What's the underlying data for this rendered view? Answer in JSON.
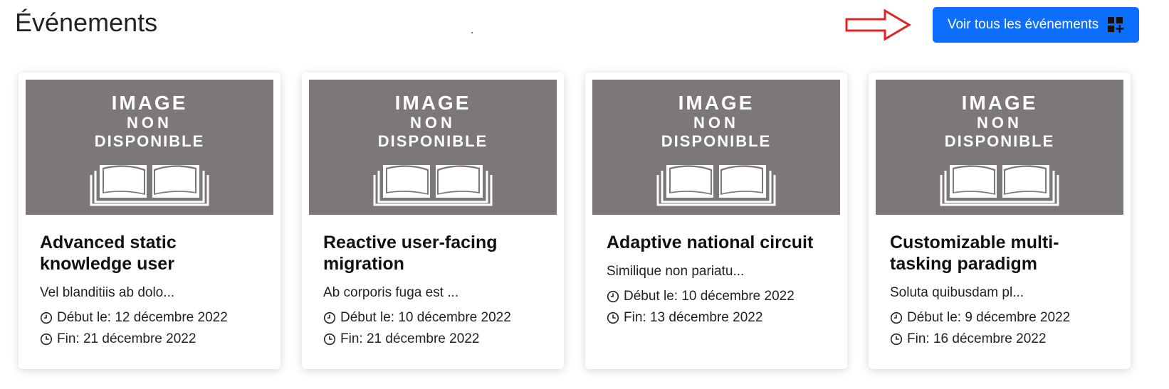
{
  "header": {
    "title": "Événements",
    "view_all_label": "Voir tous les événements",
    "view_all_icon": "grid-plus-icon",
    "annotation_arrow_color": "#e02424",
    "button_color": "#0d6efd"
  },
  "placeholder_image": {
    "line1": "IMAGE",
    "line2": "NON",
    "line3": "DISPONIBLE",
    "background": "#7c7878",
    "icon": "open-book-icon"
  },
  "events": [
    {
      "title": "Advanced static knowledge user",
      "description": "Vel blanditiis ab dolo...",
      "start_label": "Début le:",
      "start": "12 décembre 2022",
      "end_label": "Fin:",
      "end": "21 décembre 2022"
    },
    {
      "title": "Reactive user-facing migration",
      "description": "Ab corporis fuga est ...",
      "start_label": "Début le:",
      "start": "10 décembre 2022",
      "end_label": "Fin:",
      "end": "21 décembre 2022"
    },
    {
      "title": "Adaptive national circuit",
      "description": "Similique non pariatu...",
      "start_label": "Début le:",
      "start": "10 décembre 2022",
      "end_label": "Fin:",
      "end": "13 décembre 2022"
    },
    {
      "title": "Customizable multi-tasking paradigm",
      "description": "Soluta quibusdam pl...",
      "start_label": "Début le:",
      "start": "9 décembre 2022",
      "end_label": "Fin:",
      "end": "16 décembre 2022"
    }
  ]
}
